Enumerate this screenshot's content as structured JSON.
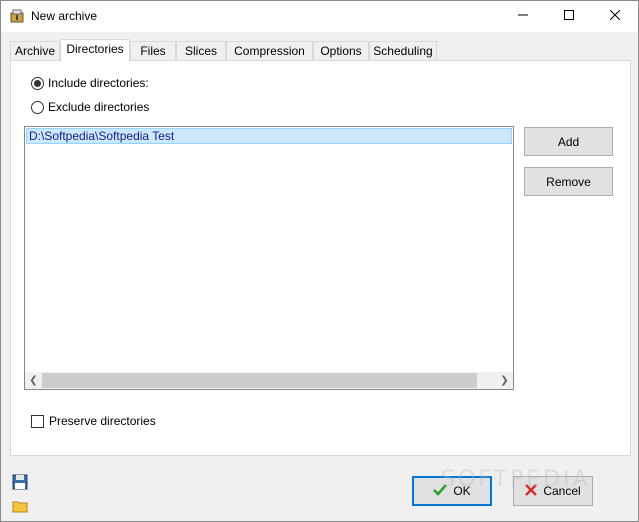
{
  "window": {
    "title": "New archive"
  },
  "tabs": [
    "Archive",
    "Directories",
    "Files",
    "Slices",
    "Compression",
    "Options",
    "Scheduling"
  ],
  "active_tab": "Directories",
  "directories": {
    "include_label": "Include directories:",
    "exclude_label": "Exclude directories",
    "selected_mode": "include",
    "list": [
      "D:\\Softpedia\\Softpedia Test"
    ],
    "add_label": "Add",
    "remove_label": "Remove",
    "preserve_label": "Preserve directories",
    "preserve_checked": false
  },
  "footer": {
    "ok_label": "OK",
    "cancel_label": "Cancel"
  },
  "watermark": "SOFTPEDIA",
  "colors": {
    "selection_bg": "#cce8ff",
    "ok_border": "#0078d7",
    "ok_check": "#2e9c2e",
    "cancel_x": "#d32f2f"
  },
  "icons": [
    "app-archive-icon",
    "minimize-icon",
    "maximize-icon",
    "close-icon",
    "save-icon",
    "folder-icon",
    "checkmark-icon",
    "cancel-x-icon",
    "scroll-left-icon",
    "scroll-right-icon"
  ]
}
